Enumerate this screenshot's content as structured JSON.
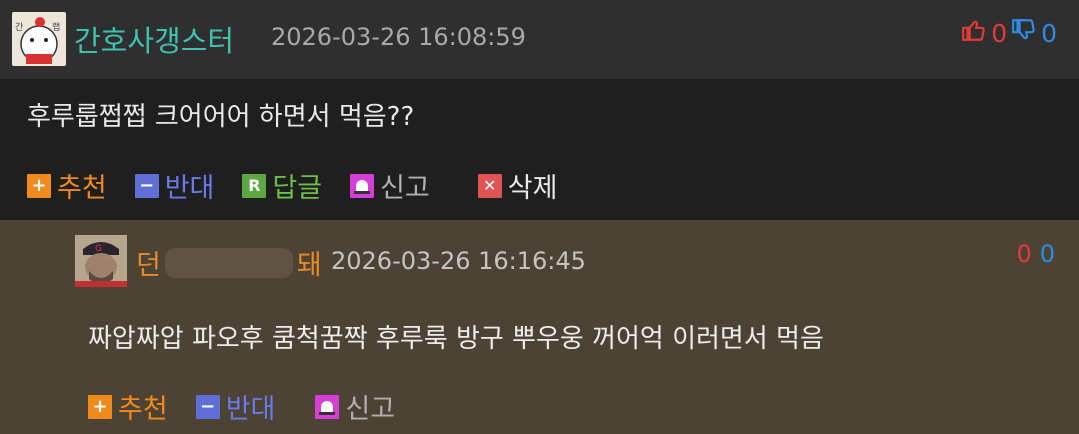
{
  "comment1": {
    "username": "간호사갱스터",
    "timestamp": "2026-03-26 16:08:59",
    "upvotes": "0",
    "downvotes": "0",
    "text": "후루룹쩝쩝 크어어어 하면서 먹음??",
    "actions": {
      "recommend": "추천",
      "oppose": "반대",
      "reply": "답글",
      "report": "신고",
      "delete": "삭제"
    }
  },
  "comment2": {
    "username_start": "던",
    "username_end": "돼",
    "timestamp": "2026-03-26 16:16:45",
    "upvotes": "0",
    "downvotes": "0",
    "text": "짜압짜압 파오후 쿰척꿈짝 후루룩 방구 뿌우웅 꺼어억 이러면서 먹음",
    "actions": {
      "recommend": "추천",
      "oppose": "반대",
      "report": "신고"
    }
  },
  "colors": {
    "username1": "#3ec2b0",
    "username2": "#e88a2a",
    "upvote": "#e13b3b",
    "downvote": "#2d8be6"
  },
  "icons": {
    "upvote": "thumbs-up-icon",
    "downvote": "thumbs-down-icon",
    "recommend": "plus-icon",
    "oppose": "minus-icon",
    "reply": "reply-r-icon",
    "report": "siren-icon",
    "delete": "x-icon"
  }
}
